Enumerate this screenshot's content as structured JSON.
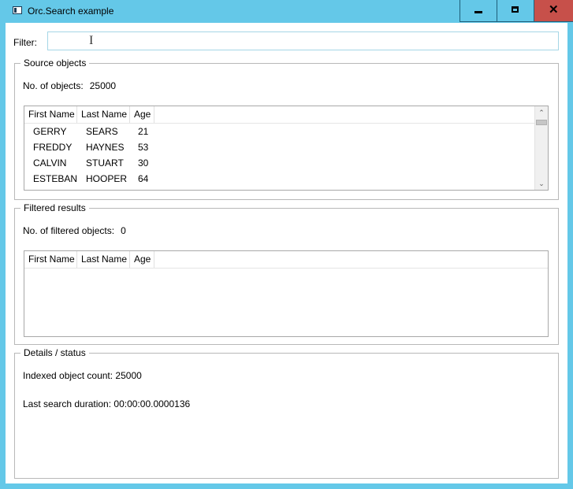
{
  "window": {
    "title": "Orc.Search example",
    "minimize_glyph": "minimize-icon",
    "maximize_glyph": "maximize-icon",
    "close_label": "✕"
  },
  "filter": {
    "label": "Filter:",
    "value": "",
    "placeholder": ""
  },
  "source": {
    "title": "Source objects",
    "count_label": "No. of objects:",
    "count_value": "25000",
    "columns": [
      "First Name",
      "Last Name",
      "Age"
    ],
    "rows": [
      {
        "first": "GERRY",
        "last": "SEARS",
        "age": "21"
      },
      {
        "first": "FREDDY",
        "last": "HAYNES",
        "age": "53"
      },
      {
        "first": "CALVIN",
        "last": "STUART",
        "age": "30"
      },
      {
        "first": "ESTEBAN",
        "last": "HOOPER",
        "age": "64"
      }
    ]
  },
  "filtered": {
    "title": "Filtered results",
    "count_label": "No. of filtered objects:",
    "count_value": "0",
    "columns": [
      "First Name",
      "Last Name",
      "Age"
    ],
    "rows": []
  },
  "details": {
    "title": "Details / status",
    "indexed_line": "Indexed object count: 25000",
    "duration_line": "Last search duration: 00:00:00.0000136"
  },
  "colors": {
    "titlebar": "#64c8e8",
    "close_button": "#c7504a",
    "input_border": "#a5d6e6"
  }
}
